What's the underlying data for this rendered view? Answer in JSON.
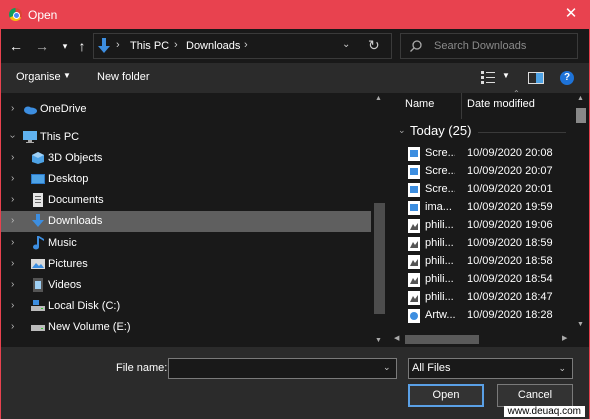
{
  "window": {
    "title": "Open"
  },
  "address": {
    "crumbs": [
      "This PC",
      "Downloads"
    ],
    "search_placeholder": "Search Downloads"
  },
  "toolbar": {
    "organise": "Organise",
    "new_folder": "New folder"
  },
  "nav": {
    "items": [
      {
        "label": "OneDrive",
        "icon": "onedrive-icon"
      },
      {
        "label": "This PC",
        "icon": "this-pc-icon"
      },
      {
        "label": "3D Objects",
        "icon": "3d-objects-icon"
      },
      {
        "label": "Desktop",
        "icon": "desktop-icon"
      },
      {
        "label": "Documents",
        "icon": "documents-icon"
      },
      {
        "label": "Downloads",
        "icon": "downloads-icon",
        "selected": true
      },
      {
        "label": "Music",
        "icon": "music-icon"
      },
      {
        "label": "Pictures",
        "icon": "pictures-icon"
      },
      {
        "label": "Videos",
        "icon": "videos-icon"
      },
      {
        "label": "Local Disk (C:)",
        "icon": "local-disk-icon"
      },
      {
        "label": "New Volume (E:)",
        "icon": "drive-icon"
      }
    ]
  },
  "files": {
    "columns": {
      "name": "Name",
      "date": "Date modified"
    },
    "group": "Today (25)",
    "rows": [
      {
        "name": "Scre...",
        "date": "10/09/2020 20:08",
        "icon": "image-file-icon"
      },
      {
        "name": "Scre...",
        "date": "10/09/2020 20:07",
        "icon": "image-file-icon"
      },
      {
        "name": "Scre...",
        "date": "10/09/2020 20:01",
        "icon": "image-file-icon"
      },
      {
        "name": "ima...",
        "date": "10/09/2020 19:59",
        "icon": "image-file-icon"
      },
      {
        "name": "phili...",
        "date": "10/09/2020 19:06",
        "icon": "photo-file-icon"
      },
      {
        "name": "phili...",
        "date": "10/09/2020 18:59",
        "icon": "photo-file-icon"
      },
      {
        "name": "phili...",
        "date": "10/09/2020 18:58",
        "icon": "photo-file-icon"
      },
      {
        "name": "phili...",
        "date": "10/09/2020 18:54",
        "icon": "photo-file-icon"
      },
      {
        "name": "phili...",
        "date": "10/09/2020 18:47",
        "icon": "photo-file-icon"
      },
      {
        "name": "Artw...",
        "date": "10/09/2020 18:28",
        "icon": "artwork-file-icon"
      }
    ]
  },
  "bottom": {
    "file_name_label": "File name:",
    "file_name_value": "",
    "filter": "All Files",
    "open": "Open",
    "cancel": "Cancel"
  },
  "watermark": "www.deuaq.com",
  "colors": {
    "accent": "#e8424f",
    "selection": "#5f5f5f",
    "focus": "#5aa0e6"
  }
}
